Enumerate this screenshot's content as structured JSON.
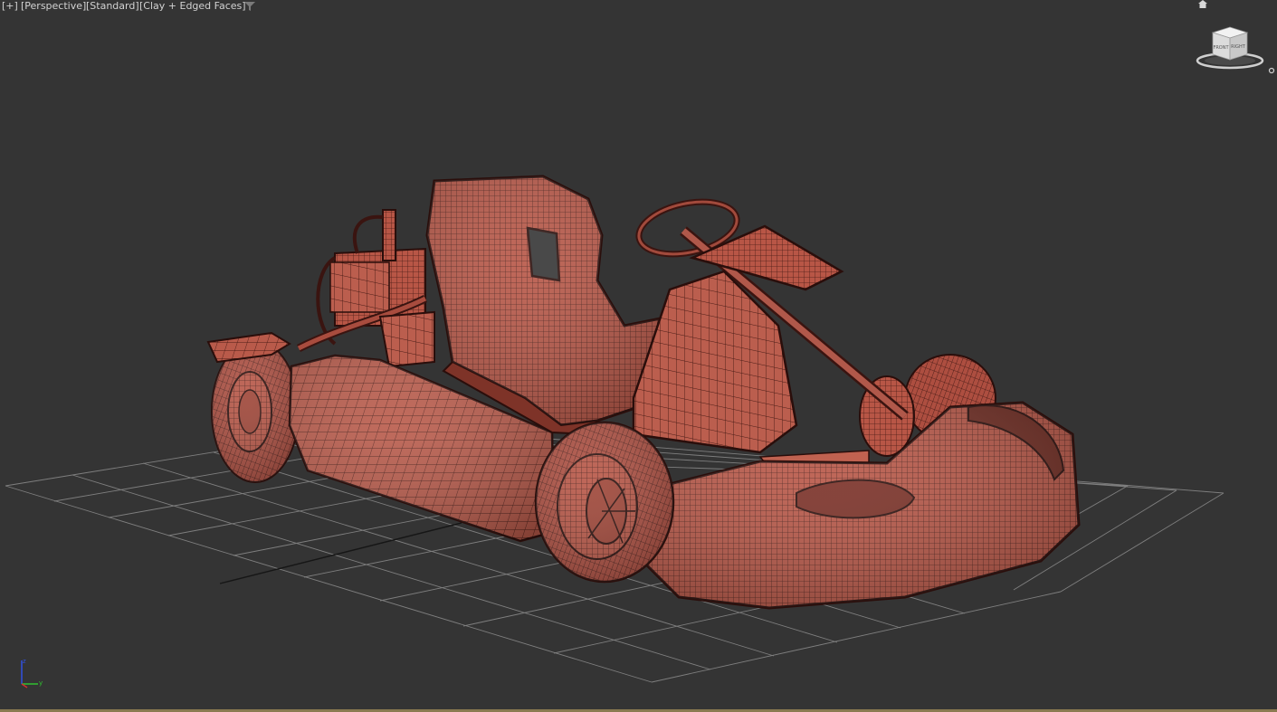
{
  "viewport": {
    "labels": {
      "plus": "[+]",
      "view": "[Perspective]",
      "shading": "[Standard]",
      "style": "[Clay + Edged Faces]"
    },
    "viewcube": {
      "front_face": "FRONT",
      "right_face": "RIGHT"
    },
    "axes": {
      "z": "z",
      "y": "y",
      "x": "x"
    }
  },
  "icons": [
    "filter-icon",
    "home-icon",
    "viewcube-menu-icon",
    "axis-tripod-icon"
  ],
  "colors": {
    "background": "#343434",
    "grid": "#8c8c8c",
    "model_fill": "#b85848",
    "model_wire": "#3a1612",
    "axis_x": "#d03030",
    "axis_y": "#30c030",
    "axis_z": "#3050e0"
  }
}
